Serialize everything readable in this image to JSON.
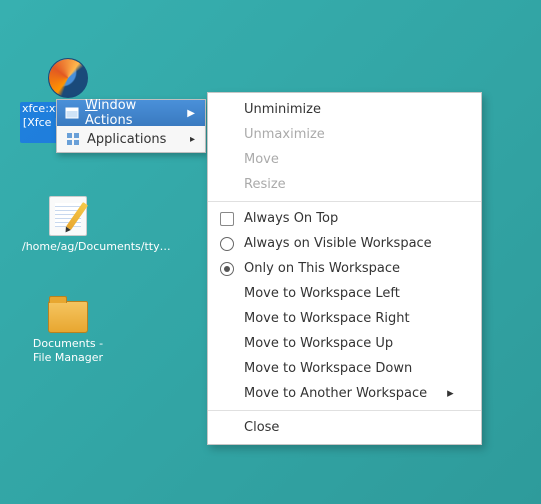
{
  "desktop": {
    "icons": [
      {
        "label": "xfce:xfwm4:wc_ref… [Xfce Docs] - Mozilla Firefox"
      },
      {
        "label": "/home/ag/Documents/tty…"
      },
      {
        "label": "Documents - File Manager"
      }
    ]
  },
  "context_menu": {
    "items": [
      {
        "label": "indow Actions",
        "mnemonic": "W"
      },
      {
        "label": "Applications"
      }
    ]
  },
  "submenu": {
    "items": [
      {
        "label": "Unminimize",
        "enabled": true,
        "type": "plain"
      },
      {
        "label": "Unmaximize",
        "enabled": false,
        "type": "plain"
      },
      {
        "label": "Move",
        "enabled": false,
        "type": "plain"
      },
      {
        "label": "Resize",
        "enabled": false,
        "type": "plain"
      },
      {
        "label": "Always On Top",
        "enabled": true,
        "type": "checkbox",
        "checked": false
      },
      {
        "label": "Always on Visible Workspace",
        "enabled": true,
        "type": "radio",
        "checked": false
      },
      {
        "label": "Only on This Workspace",
        "enabled": true,
        "type": "radio",
        "checked": true
      },
      {
        "label": "Move to Workspace Left",
        "enabled": true,
        "type": "plain"
      },
      {
        "label": "Move to Workspace Right",
        "enabled": true,
        "type": "plain"
      },
      {
        "label": "Move to Workspace Up",
        "enabled": true,
        "type": "plain"
      },
      {
        "label": "Move to Workspace Down",
        "enabled": true,
        "type": "plain"
      },
      {
        "label": "Move to Another Workspace",
        "enabled": true,
        "type": "submenu"
      },
      {
        "label": "Close",
        "enabled": true,
        "type": "plain"
      }
    ]
  }
}
